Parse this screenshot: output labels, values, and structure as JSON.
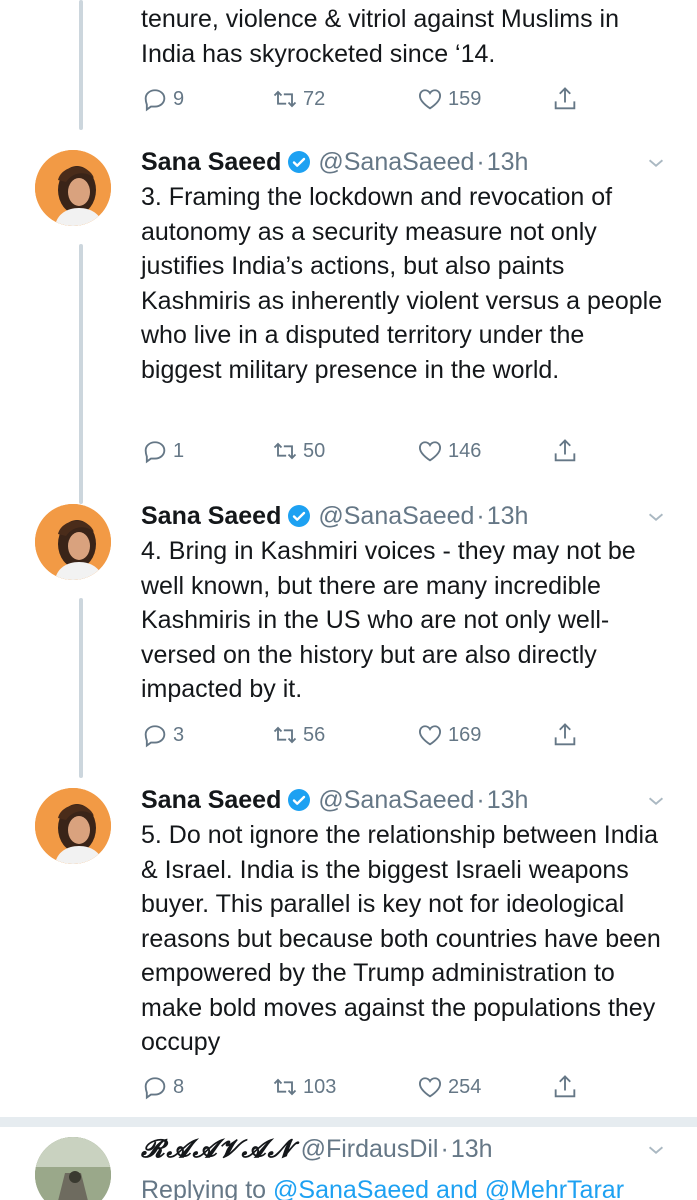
{
  "tweets": [
    {
      "body": "tenure, violence & vitriol against Muslims in India has skyrocketed since ‘14.",
      "replies": "9",
      "retweets": "72",
      "likes": "159"
    },
    {
      "name": "Sana Saeed",
      "handle": "@SanaSaeed",
      "time": "13h",
      "body": "3. Framing the lockdown and revocation of autonomy as a security measure not only justifies India’s actions, but also paints Kashmiris as inherently violent versus a people who live in a disputed territory under the biggest military presence in the world.",
      "replies": "1",
      "retweets": "50",
      "likes": "146"
    },
    {
      "name": "Sana Saeed",
      "handle": "@SanaSaeed",
      "time": "13h",
      "body": "4. Bring in Kashmiri voices - they may not be well known, but there are many incredible Kashmiris in the US who are not only well-versed on the history but are also directly impacted by it.",
      "replies": "3",
      "retweets": "56",
      "likes": "169"
    },
    {
      "name": "Sana Saeed",
      "handle": "@SanaSaeed",
      "time": "13h",
      "body": "5. Do not ignore the relationship between India & Israel. India is the biggest Israeli weapons buyer. This parallel is key not for ideological reasons but because both countries have been empowered by the Trump administration to make bold moves against the populations they occupy",
      "replies": "8",
      "retweets": "103",
      "likes": "254"
    }
  ],
  "reply": {
    "name": "𝓡𝓐𝓐𝓥𝓐𝓝",
    "handle": "@FirdausDil",
    "time": "13h",
    "replying_prefix": "Replying to",
    "replying_to_1": "@SanaSaeed",
    "replying_and": "and",
    "replying_to_2": "@MehrTarar"
  },
  "separator": "·",
  "colors": {
    "accent": "#1da1f2",
    "muted": "#657786",
    "text": "#14171a",
    "thread": "#ccd6dd"
  },
  "icons": [
    "reply-icon",
    "retweet-icon",
    "like-icon",
    "share-icon",
    "verified-badge-icon",
    "chevron-down-icon"
  ]
}
